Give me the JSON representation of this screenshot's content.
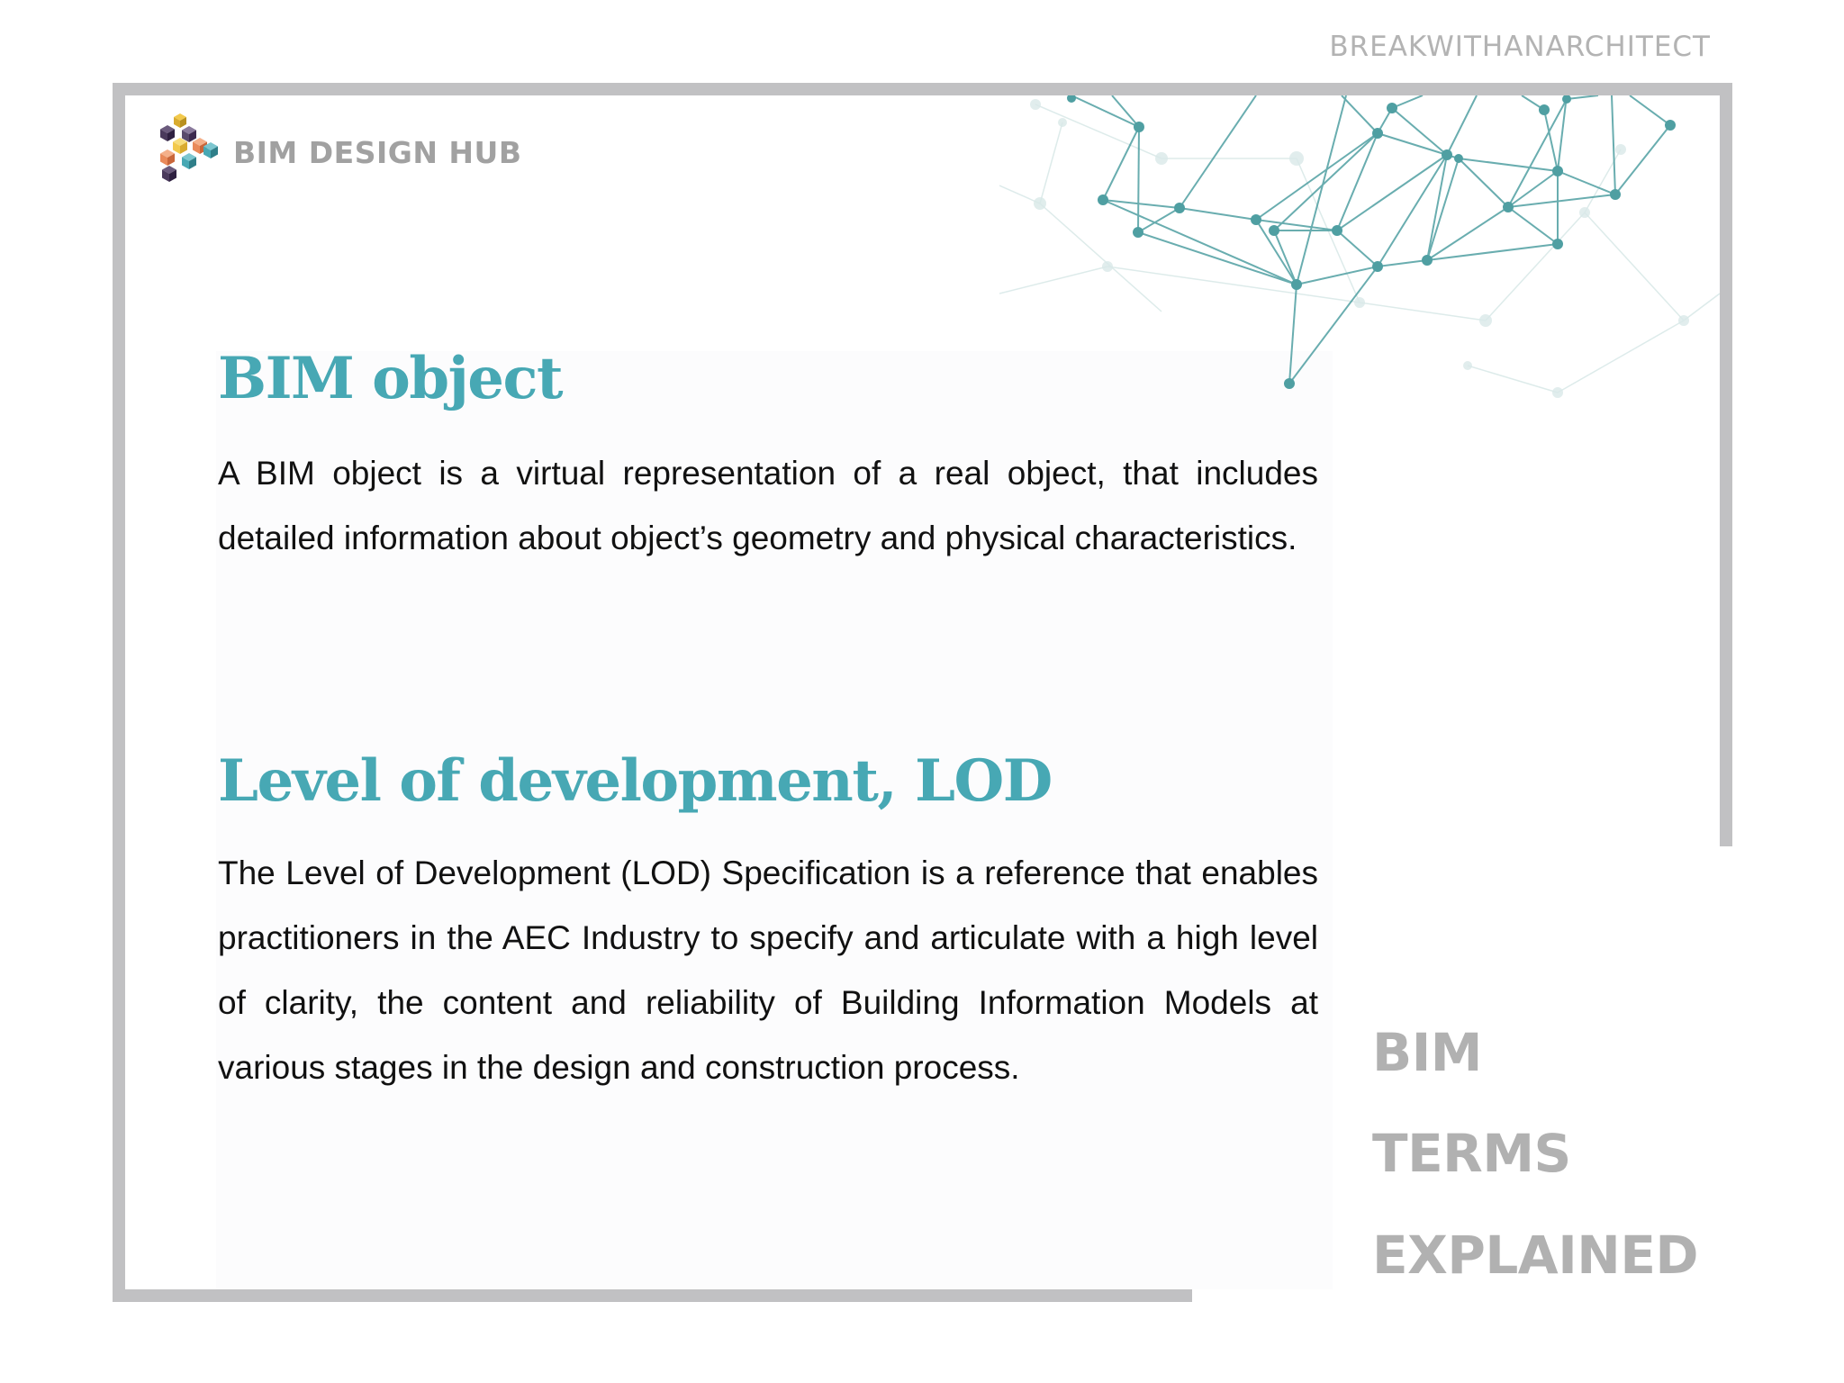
{
  "watermark": "BREAKWITHANARCHITECT",
  "brand": {
    "name": "BIM DESIGN HUB",
    "logo_icon": "stacked-cubes-logo",
    "logo_colors": [
      "#3d2a4f",
      "#f2c94c",
      "#e98a5a",
      "#47a8b4"
    ]
  },
  "decoration": {
    "icon": "network-graph-icon",
    "color": "#4f9fa2"
  },
  "sections": [
    {
      "title": "BIM object",
      "body": "A BIM object is a virtual representation of a real object, that includes detailed information about object’s geometry and physical characteristics."
    },
    {
      "title": "Level of development, LOD",
      "body": "The Level of Development (LOD) Specification is a reference that enables practitioners in the AEC Industry to specify and articulate with a high level of clarity, the content and reliability of Building Information Models at various stages in the design and construction process."
    }
  ],
  "side_title": [
    "BIM",
    "TERMS",
    "EXPLAINED"
  ],
  "colors": {
    "heading": "#47a8b4",
    "frame": "#c1c1c3",
    "side_text": "#b1b1b1",
    "body_text": "#111111"
  }
}
